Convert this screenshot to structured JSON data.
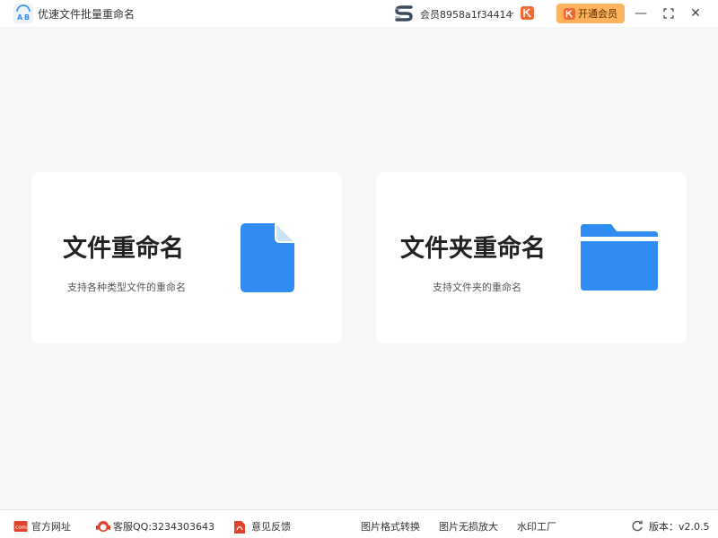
{
  "titlebar": {
    "app_title": "优速文件批量重命名",
    "user_label": "会员8958a1f34414",
    "open_vip_label": "开通会员",
    "minimize": "—",
    "maximize": "⛶",
    "close": "✕",
    "caret": "⌄"
  },
  "cards": [
    {
      "title": "文件重命名",
      "description": "支持各种类型文件的重命名",
      "icon": "file-icon"
    },
    {
      "title": "文件夹重命名",
      "description": "支持文件夹的重命名",
      "icon": "folder-icon"
    }
  ],
  "footer": {
    "website": "官方网址",
    "support_qq": "客服QQ:3234303643",
    "feedback": "意见反馈",
    "image_convert": "图片格式转换",
    "image_enlarge": "图片无损放大",
    "watermark": "水印工厂",
    "version": "版本：v2.0.5"
  },
  "colors": {
    "accent_blue": "#2f8cf0",
    "vip_orange": "#fdb25e",
    "vip_red": "#f06a35",
    "background": "#f5f6f8"
  }
}
